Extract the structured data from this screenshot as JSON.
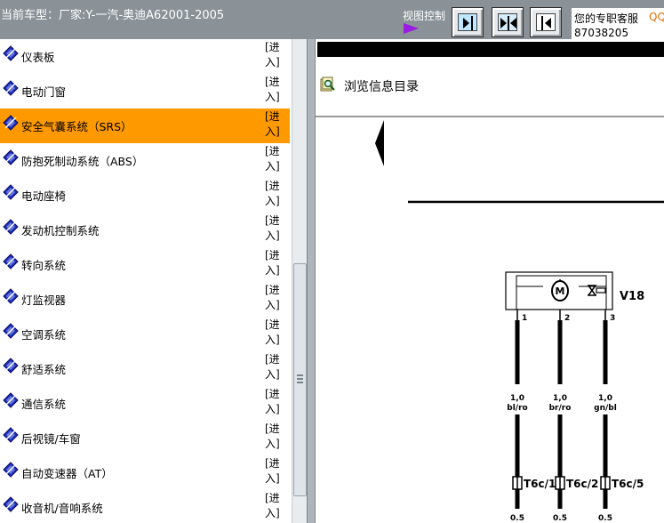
{
  "header": {
    "car_model": "当前车型：厂家:Y-一汽-奥迪A62001-2005",
    "view_control_label": "视图控制",
    "service_label": "您的专职客服",
    "service_qq": "QQ",
    "service_phone": "87038205"
  },
  "menu": {
    "enter_label_top": "[进",
    "enter_label_bottom": "入]",
    "selected_index": 2,
    "items": [
      {
        "label": "仪表板"
      },
      {
        "label": "电动门窗"
      },
      {
        "label": "安全气囊系统（SRS）"
      },
      {
        "label": "防抱死制动系统（ABS）"
      },
      {
        "label": "电动座椅"
      },
      {
        "label": "发动机控制系统"
      },
      {
        "label": "转向系统"
      },
      {
        "label": "灯监视器"
      },
      {
        "label": "空调系统"
      },
      {
        "label": "舒适系统"
      },
      {
        "label": "通信系统"
      },
      {
        "label": "后视镜/车窗"
      },
      {
        "label": "自动变速器（AT）"
      },
      {
        "label": "收音机/音响系统"
      }
    ]
  },
  "browse": {
    "label": "浏览信息目录",
    "icon": "book-magnifier-icon"
  },
  "diagram": {
    "component": "V18",
    "motor_symbol": "M",
    "pins": [
      "1",
      "2",
      "3"
    ],
    "wires": [
      {
        "gauge": "1,0",
        "color": "bl/ro",
        "connector": "T6c/1",
        "bottom_gauge": "0.5"
      },
      {
        "gauge": "1,0",
        "color": "br/ro",
        "connector": "T6c/2",
        "bottom_gauge": "0.5"
      },
      {
        "gauge": "1,0",
        "color": "gn/bl",
        "connector": "T6c/5",
        "bottom_gauge": "0.5"
      }
    ]
  },
  "colors": {
    "header_bg": "#8a9298",
    "selected_bg": "#ff9900",
    "arrow_purple": "#9a1ce0",
    "qq_orange": "#e07000"
  }
}
